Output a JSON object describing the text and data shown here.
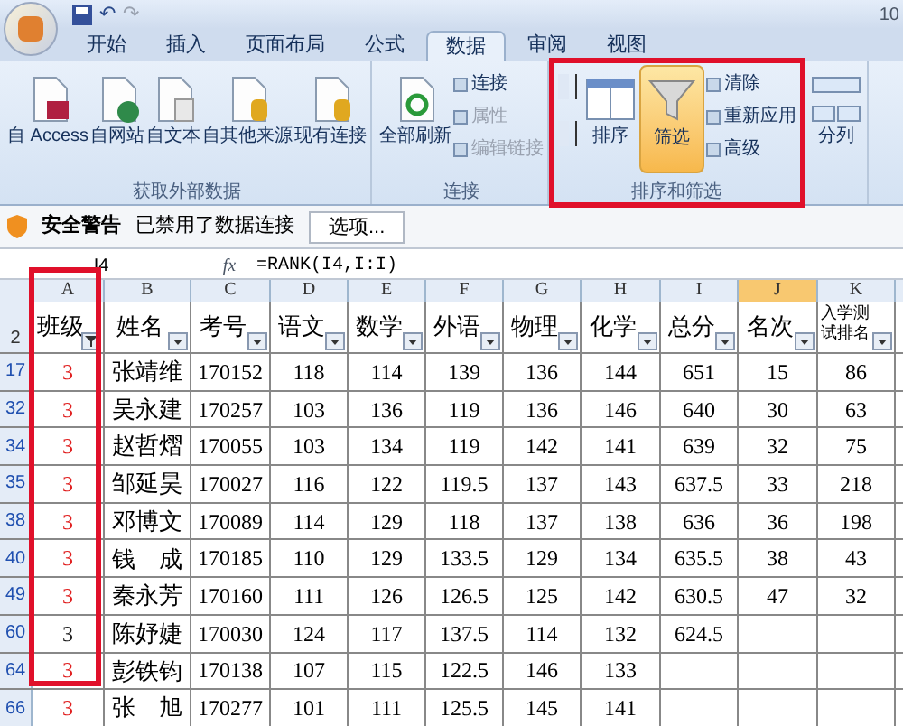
{
  "window": {
    "title": "10"
  },
  "quick_access": [
    "↶",
    "↷"
  ],
  "tabs": [
    {
      "label": "开始",
      "selected": false
    },
    {
      "label": "插入",
      "selected": false
    },
    {
      "label": "页面布局",
      "selected": false
    },
    {
      "label": "公式",
      "selected": false
    },
    {
      "label": "数据",
      "selected": true
    },
    {
      "label": "审阅",
      "selected": false
    },
    {
      "label": "视图",
      "selected": false
    }
  ],
  "ribbon_groups": [
    {
      "title": "获取外部数据",
      "highlighted": false,
      "items": [
        {
          "kind": "access",
          "label": "自 Access",
          "active": false
        },
        {
          "kind": "web",
          "label": "自网站",
          "active": false
        },
        {
          "kind": "text",
          "label": "自文本",
          "active": false
        },
        {
          "kind": "db",
          "label": "自其他来源",
          "active": false
        },
        {
          "kind": "db",
          "label": "现有连接",
          "active": false
        }
      ]
    },
    {
      "title": "连接",
      "highlighted": false,
      "items": [
        {
          "kind": "refresh",
          "label": "全部刷新",
          "active": false
        },
        {
          "kind": "stack",
          "items": [
            {
              "label": "连接",
              "disabled": false
            },
            {
              "label": "属性",
              "disabled": true
            },
            {
              "label": "编辑链接",
              "disabled": true
            }
          ]
        }
      ]
    },
    {
      "title": "排序和筛选",
      "highlighted": true,
      "items": [
        {
          "kind": "sortpair"
        },
        {
          "kind": "sort",
          "label": "排序",
          "active": false
        },
        {
          "kind": "filter",
          "label": "筛选",
          "active": true
        },
        {
          "kind": "stack",
          "items": [
            {
              "label": "清除",
              "disabled": false
            },
            {
              "label": "重新应用",
              "disabled": false
            },
            {
              "label": "高级",
              "disabled": false
            }
          ]
        }
      ]
    },
    {
      "highlighted": false,
      "items": [
        {
          "kind": "split",
          "label": "分列",
          "active": false
        }
      ]
    }
  ],
  "security_bar": {
    "title": "安全警告",
    "message": "已禁用了数据连接",
    "button": "选项..."
  },
  "formula_bar": {
    "name_box": "I4",
    "fx": "fx",
    "formula": "=RANK(I4,I:I)"
  },
  "columns": [
    {
      "letter": "A",
      "header": "班级",
      "filtered": true,
      "selected": false
    },
    {
      "letter": "B",
      "header": "姓名",
      "filtered": false,
      "selected": false
    },
    {
      "letter": "C",
      "header": "考号",
      "filtered": false,
      "selected": false
    },
    {
      "letter": "D",
      "header": "语文",
      "filtered": false,
      "selected": false
    },
    {
      "letter": "E",
      "header": "数学",
      "filtered": false,
      "selected": false
    },
    {
      "letter": "F",
      "header": "外语",
      "filtered": false,
      "selected": false
    },
    {
      "letter": "G",
      "header": "物理",
      "filtered": false,
      "selected": false
    },
    {
      "letter": "H",
      "header": "化学",
      "filtered": false,
      "selected": false
    },
    {
      "letter": "I",
      "header": "总分",
      "filtered": false,
      "selected": false
    },
    {
      "letter": "J",
      "header": "名次",
      "filtered": false,
      "selected": true
    },
    {
      "letter": "K",
      "header": "入学测试排名",
      "filtered": false,
      "selected": false
    }
  ],
  "header_row": "2",
  "rows": [
    {
      "row": "17",
      "color": "#e02020",
      "cells": [
        "3",
        "张靖维",
        "170152",
        "118",
        "114",
        "139",
        "136",
        "144",
        "651",
        "15",
        "86"
      ]
    },
    {
      "row": "32",
      "color": "#e02020",
      "cells": [
        "3",
        "吴永建",
        "170257",
        "103",
        "136",
        "119",
        "136",
        "146",
        "640",
        "30",
        "63"
      ]
    },
    {
      "row": "34",
      "color": "#e02020",
      "cells": [
        "3",
        "赵哲熠",
        "170055",
        "103",
        "134",
        "119",
        "142",
        "141",
        "639",
        "32",
        "75"
      ]
    },
    {
      "row": "35",
      "color": "#e02020",
      "cells": [
        "3",
        "邹延昊",
        "170027",
        "116",
        "122",
        "119.5",
        "137",
        "143",
        "637.5",
        "33",
        "218"
      ]
    },
    {
      "row": "38",
      "color": "#e02020",
      "cells": [
        "3",
        "邓博文",
        "170089",
        "114",
        "129",
        "118",
        "137",
        "138",
        "636",
        "36",
        "198"
      ]
    },
    {
      "row": "40",
      "color": "#e02020",
      "cells": [
        "3",
        "钱　成",
        "170185",
        "110",
        "129",
        "133.5",
        "129",
        "134",
        "635.5",
        "38",
        "43"
      ]
    },
    {
      "row": "49",
      "color": "#e02020",
      "cells": [
        "3",
        "秦永芳",
        "170160",
        "111",
        "126",
        "126.5",
        "125",
        "142",
        "630.5",
        "47",
        "32"
      ]
    },
    {
      "row": "60",
      "color": "#202020",
      "cells": [
        "3",
        "陈妤婕",
        "170030",
        "124",
        "117",
        "137.5",
        "114",
        "132",
        "624.5"
      ]
    },
    {
      "row": "64",
      "color": "#e02020",
      "cells": [
        "3",
        "彭铁钧",
        "170138",
        "107",
        "115",
        "122.5",
        "146",
        "133"
      ]
    },
    {
      "row": "66",
      "color": "#e02020",
      "cells": [
        "3",
        "张　旭",
        "170277",
        "101",
        "111",
        "125.5",
        "145",
        "141"
      ]
    }
  ]
}
